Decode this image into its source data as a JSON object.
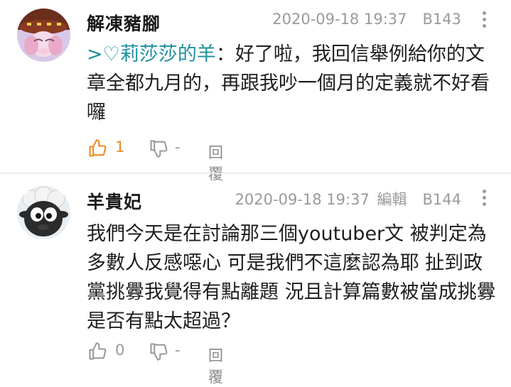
{
  "comments": [
    {
      "username": "解凍豬腳",
      "timestamp": "2020-09-18 19:37",
      "edited": "",
      "floor": "B143",
      "reply_ref": ">♡莉莎莎的羊",
      "text": "：好了啦，我回信舉例給你的文章全都九月的，再跟我吵一個月的定義就不好看囉",
      "likes": "1",
      "dislikes": "-",
      "reply_label": "回覆",
      "like_active": true,
      "accent_color": "#ef8a1e"
    },
    {
      "username": "羊貴妃",
      "timestamp": "2020-09-18 19:37",
      "edited": "編輯",
      "floor": "B144",
      "reply_ref": "",
      "text": "我們今天是在討論那三個youtuber文 被判定為多數人反感噁心 可是我們不這麼認為耶 扯到政黨挑釁我覺得有點離題 況且計算篇數被當成挑釁 是否有點太超過？",
      "likes": "0",
      "dislikes": "-",
      "reply_label": "回覆",
      "like_active": false
    }
  ],
  "icons": {
    "like": "thumbs-up-icon",
    "dislike": "thumbs-down-icon",
    "more": "more-vertical-icon"
  },
  "colors": {
    "reply_ref": "#1f8fa0",
    "meta": "#9a9a9a"
  }
}
